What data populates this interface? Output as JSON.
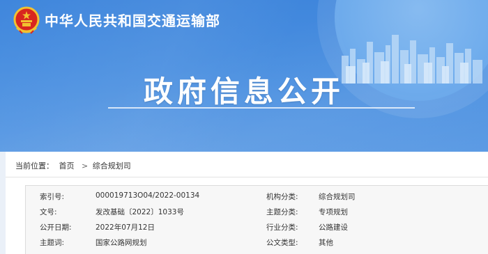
{
  "header": {
    "site_name": "中华人民共和国交通运输部",
    "hero_title": "政府信息公开"
  },
  "icons": {
    "emblem": "national-emblem-icon",
    "skyline": "city-skyline-graphic"
  },
  "colors": {
    "banner": "#4a8fe0",
    "emblem_red": "#d8261f",
    "emblem_gold": "#f2c230"
  },
  "breadcrumb": {
    "label": "当前位置：",
    "home": "首页",
    "separator": ">",
    "current": "综合规划司"
  },
  "info": {
    "rows": [
      {
        "label1": "索引号:",
        "value1": "000019713O04/2022-00134",
        "label2": "机构分类:",
        "value2": "综合规划司"
      },
      {
        "label1": "文号:",
        "value1": "发改基础〔2022〕1033号",
        "label2": "主题分类:",
        "value2": "专项规划"
      },
      {
        "label1": "公开日期:",
        "value1": "2022年07月12日",
        "label2": "行业分类:",
        "value2": "公路建设"
      },
      {
        "label1": "主题词:",
        "value1": "国家公路网规划",
        "label2": "公文类型:",
        "value2": "其他"
      }
    ]
  }
}
